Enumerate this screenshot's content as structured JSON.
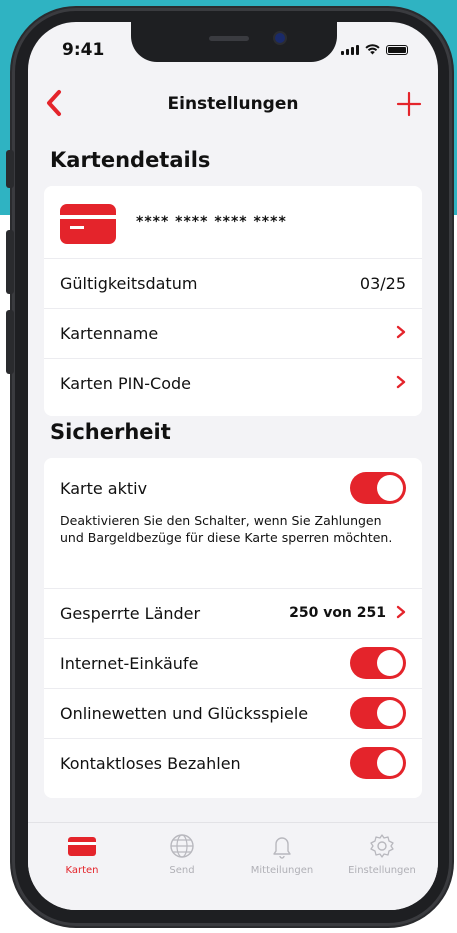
{
  "status_bar": {
    "time": "9:41"
  },
  "nav": {
    "title": "Einstellungen",
    "back_icon": "chevron-left-icon",
    "add_icon": "plus-icon"
  },
  "card_details": {
    "section_title": "Kartendetails",
    "card_number_masked": "**** **** **** ****",
    "expiry_label": "Gültigkeitsdatum",
    "expiry_value": "03/25",
    "card_name_label": "Kartenname",
    "pin_label": "Karten PIN-Code"
  },
  "security": {
    "section_title": "Sicherheit",
    "card_active_label": "Karte aktiv",
    "card_active_on": true,
    "card_active_desc": "Deaktivieren Sie den Schalter, wenn Sie Zahlungen und Bargeldbezüge für diese Karte sperren möchten.",
    "blocked_countries_label": "Gesperrte Länder",
    "blocked_countries_value": "250 von 251",
    "online_shopping_label": "Internet-Einkäufe",
    "online_shopping_on": true,
    "gambling_label": "Onlinewetten und Glücksspiele",
    "gambling_on": true,
    "contactless_label": "Kontaktloses Bezahlen",
    "contactless_on": true
  },
  "tabbar": {
    "tabs": [
      {
        "label": "Karten",
        "icon": "card-icon",
        "active": true
      },
      {
        "label": "Send",
        "icon": "globe-icon",
        "active": false
      },
      {
        "label": "Mitteilungen",
        "icon": "bell-icon",
        "active": false
      },
      {
        "label": "Einstellungen",
        "icon": "gear-icon",
        "active": false
      }
    ]
  },
  "colors": {
    "accent": "#e4242b",
    "background": "#f3f3f6",
    "frame": "#1e1f22",
    "backdrop": "#2fb3c2"
  }
}
